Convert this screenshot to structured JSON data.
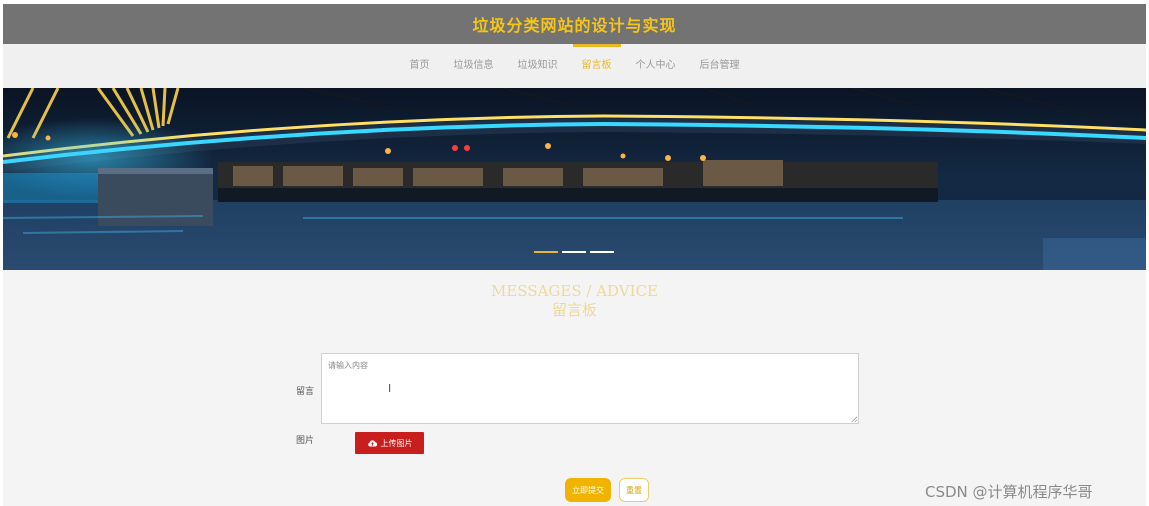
{
  "header": {
    "site_title": "垃圾分类网站的设计与实现"
  },
  "nav": {
    "items": [
      {
        "label": "首页",
        "active": false
      },
      {
        "label": "垃圾信息",
        "active": false
      },
      {
        "label": "垃圾知识",
        "active": false
      },
      {
        "label": "留言板",
        "active": true
      },
      {
        "label": "个人中心",
        "active": false
      },
      {
        "label": "后台管理",
        "active": false
      }
    ],
    "active_color": "#e8b923"
  },
  "banner": {
    "image": "night-bridge-city-lights",
    "slides": 3,
    "active_slide": 1
  },
  "section": {
    "title_en": "MESSAGES / ADVICE",
    "title_cn": "留言板"
  },
  "form": {
    "message_label": "留言",
    "message_placeholder": "请输入内容",
    "image_label": "图片",
    "upload_label": "上传图片",
    "upload_icon": "cloud-upload-icon",
    "submit_label": "立即提交",
    "reset_label": "重置"
  },
  "watermark": "CSDN @计算机程序华哥",
  "colors": {
    "header_bg": "#737373",
    "accent": "#f5c518",
    "upload_button": "#c81e1e",
    "submit_button": "#f0b400"
  }
}
